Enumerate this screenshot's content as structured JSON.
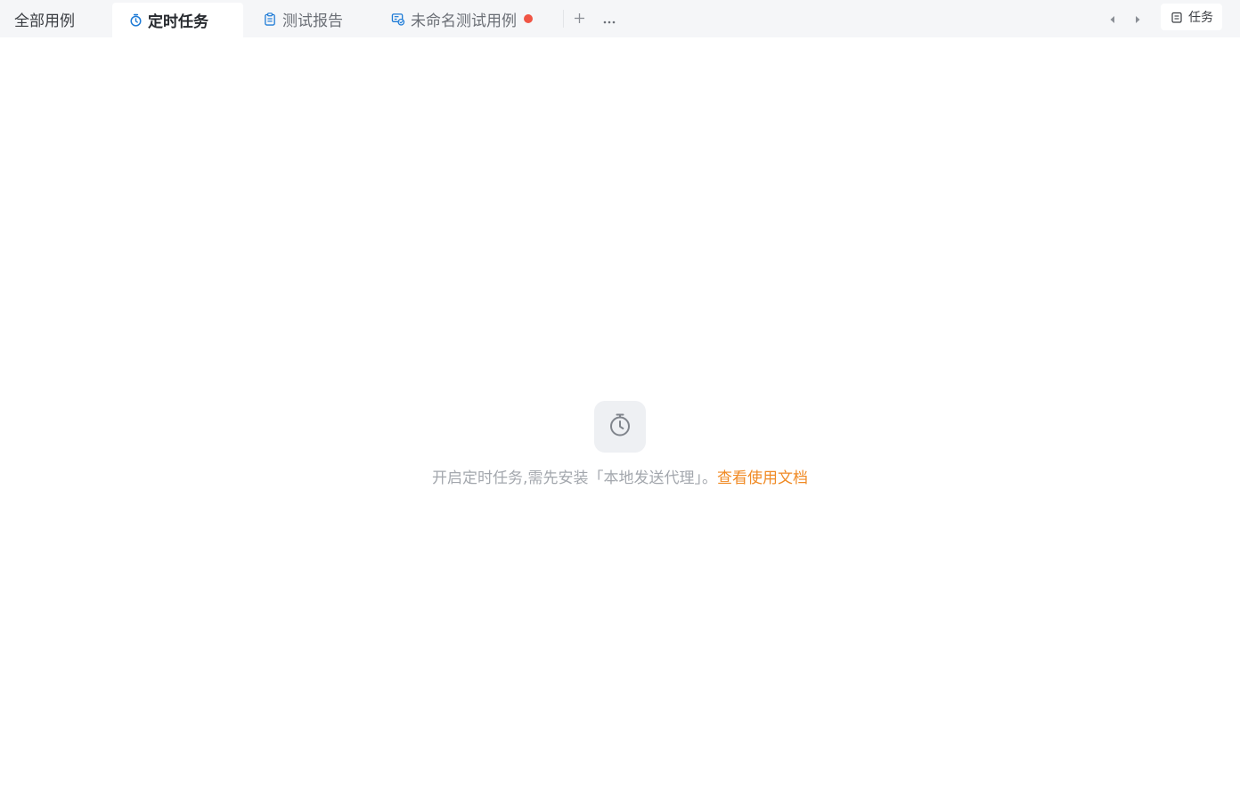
{
  "tabs": {
    "all_cases": {
      "label": "全部用例"
    },
    "scheduled": {
      "label": "定时任务",
      "icon": "timer-icon",
      "active": true
    },
    "report": {
      "label": "测试报告",
      "icon": "clipboard-icon"
    },
    "unnamed_case": {
      "label": "未命名测试用例",
      "icon": "test-case-icon",
      "unsaved": true
    }
  },
  "toolbar": {
    "add_icon": "plus-icon",
    "more_icon": "more-icon",
    "prev_icon": "caret-left-icon",
    "next_icon": "caret-right-icon",
    "task_label": "任务"
  },
  "empty_state": {
    "icon": "timer-icon",
    "message": "开启定时任务,需先安装「本地发送代理」。",
    "link_label": "查看使用文档"
  },
  "colors": {
    "accent_blue": "#1e7bd6",
    "link_orange": "#f08a24",
    "unsaved_dot": "#f05545"
  }
}
